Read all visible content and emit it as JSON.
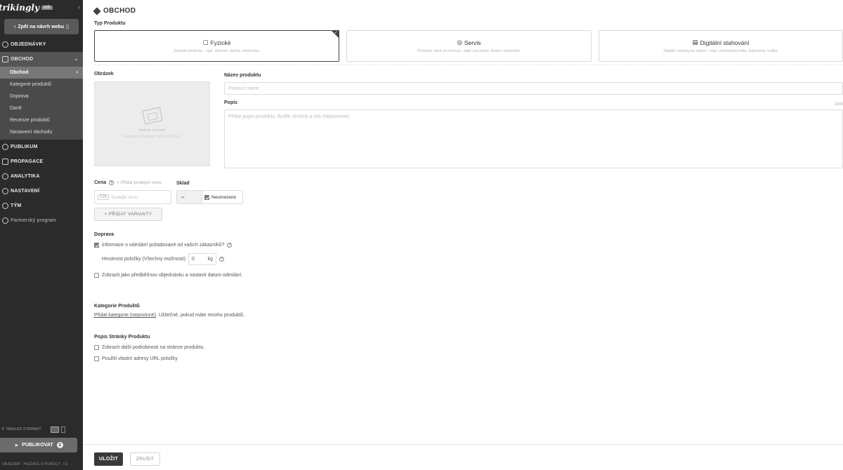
{
  "sidebar": {
    "brand": "trikingly",
    "brand_badge": "VIP",
    "back_label": "Zpět na návrh webu",
    "nav": [
      {
        "label": "OBJEDNÁVKY"
      },
      {
        "label": "OBCHOD"
      },
      {
        "label": "PUBLIKUM"
      },
      {
        "label": "PROPAGACE"
      },
      {
        "label": "ANALYTIKA"
      },
      {
        "label": "NASTAVENÍ"
      },
      {
        "label": "TÝM"
      },
      {
        "label": "Partnerský program"
      }
    ],
    "sub_items": [
      "Obchod",
      "Kategorie produktů",
      "Doprava",
      "Daně",
      "Recenze produktů",
      "Nastavení obchodu"
    ],
    "preview_label": "NÁHLED STRÁNKY",
    "publish_label": "PUBLIKOVAT",
    "publish_count": "1",
    "footer_items": [
      "OBJEDNAT",
      "HLEDÁTE SI POMOC?",
      "CS",
      "..."
    ]
  },
  "page": {
    "title": "OBCHOD",
    "type_label": "Typ Produktu",
    "types": [
      {
        "title": "Fyzické",
        "desc": "Zasílané předměty - např. oblečení, šperky, elektronika."
      },
      {
        "title": "Servis",
        "desc": "Předměty, které se rezervují - např. procházky, školení, koučování."
      },
      {
        "title": "Digitální stahování",
        "desc": "Digitální soubory ke stažení - např. elektronické knihy, dokumenty, hudba."
      }
    ],
    "image_label": "Obrázek",
    "image_text": "Nahrát obrázek",
    "image_subtext": "Doporučená velikost: 1000 x 1000 px",
    "name_label": "Název produktu",
    "name_placeholder": "Product name",
    "desc_label": "Popis",
    "desc_placeholder": "Přidat popis produktu. Buďte stručný a milí (Nepovinné)",
    "desc_counter": "1/500",
    "price_label": "Cena",
    "add_price_label": "+ Přidat prodejní cenu",
    "price_currency": "CZK",
    "price_placeholder": "Zadejte cenu",
    "stock_label": "Sklad",
    "stock_value": "∞",
    "stock_unlimited": "Neomezené",
    "add_variant_label": "+ PŘIDAT VARIANTY",
    "shipping_label": "Doprava",
    "shipping_address_option": "Informace o odeslání požadované od vašich zákazníků?",
    "weight_label": "Hmotnost položky (Všechny možnosti)",
    "weight_value": "0",
    "weight_unit": "kg",
    "preorder_option": "Zobrazit jako předběžnou objednávku a nastavit datum odeslání.",
    "category_label": "Kategorie Produktů",
    "category_link": "Přidat kategorie (nepovinné)",
    "category_hint": ". Užitečné, pokud máte mnoho produktů.",
    "page_desc_label": "Popis Stránky Produktu",
    "page_desc_option1": "Zobrazit další podrobnosti na stránce produktu.",
    "page_desc_option2": "Použití vlastní adresy URL položky"
  },
  "footer": {
    "save_label": "ULOŽIT",
    "cancel_label": "ZRUŠIT"
  },
  "colors": {
    "sidebar_bg": "#2b2b2b",
    "active_item": "#555555",
    "accent_dark": "#3a3a3a"
  }
}
